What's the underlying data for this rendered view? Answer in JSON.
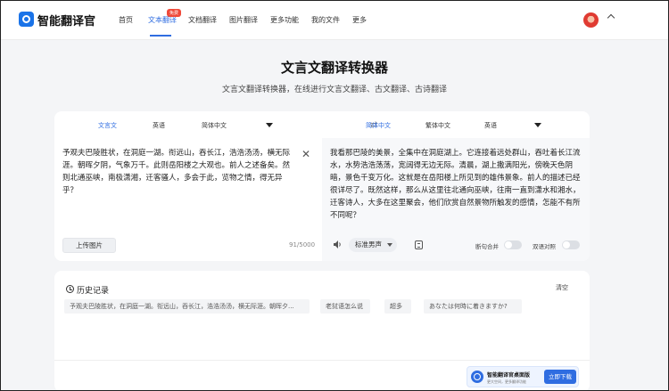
{
  "header": {
    "logo_text": "智能翻译官",
    "nav": [
      {
        "label": "首页"
      },
      {
        "label": "文本翻译",
        "badge": "免费"
      },
      {
        "label": "文档翻译"
      },
      {
        "label": "图片翻译"
      },
      {
        "label": "更多功能"
      },
      {
        "label": "我的文件"
      },
      {
        "label": "更多"
      }
    ],
    "active_nav_index": 1
  },
  "hero": {
    "title": "文言文翻译转换器",
    "subtitle": "文言文翻译转换器，在线进行文言文翻译、古文翻译、古诗翻译"
  },
  "translator": {
    "source_langs": [
      "文言文",
      "英语",
      "简体中文"
    ],
    "source_active_index": 0,
    "target_langs": [
      "简体中文",
      "繁体中文",
      "英语"
    ],
    "target_active_index": 0,
    "source_text": "予观夫巴陵胜状，在洞庭一湖。衔远山，吞长江，浩浩汤汤，横无际涯。朝晖夕阴，气象万千。此则岳阳楼之大观也。前人之述备矣。然则北通巫峡，南极潇湘，迁客骚人，多会于此，览物之情，得无异乎？",
    "translated_text": "我看那巴陵的美景，全集中在洞庭湖上。它连接着远处群山，吞吐着长江流水，水势浩浩荡荡，宽阔得无边无际。清晨，湖上撒满阳光，傍晚天色阴暗，景色千变万化。这就是在岳阳楼上所见到的雄伟景象。前人的描述已经很详尽了。既然这样，那么从这里往北通向巫峡，往南一直到潇水和湘水，迁客诗人，大多在这里聚会，他们欣赏自然景物所触发的感情，怎能不有所不同呢？",
    "upload_label": "上传图片",
    "char_count": "91/5000",
    "voice": "标准男声",
    "toggle_sentence_merge": "断句合并",
    "toggle_bilingual": "双语对照"
  },
  "history": {
    "title": "历史记录",
    "clear_label": "清空",
    "items": [
      "予观夫巴陵胜状，在洞庭一湖。衔远山，吞长江，浩浩汤汤，横无际涯。朝晖夕...",
      "老挝语怎么说",
      "超多",
      "あなたは何時に着きますか?"
    ]
  },
  "promo": {
    "title": "智能翻译官桌面版",
    "subtitle": "更大空间，更多翻译功能",
    "button": "立即下载"
  },
  "colors": {
    "accent": "#2f6de1",
    "badge": "#ef4a3a",
    "page_bg": "#f4f5f7"
  }
}
